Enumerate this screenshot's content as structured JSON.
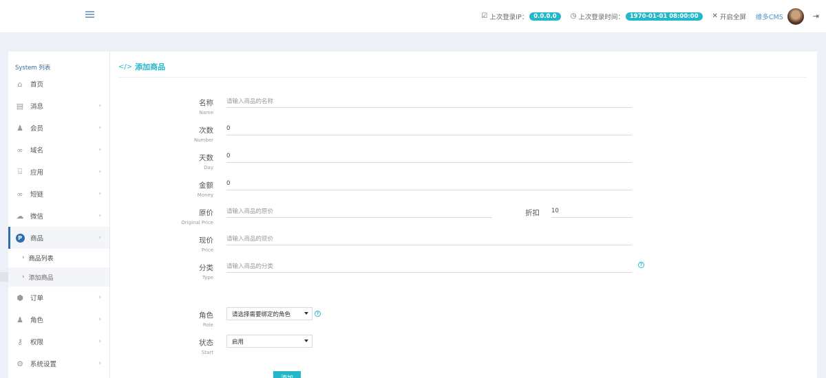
{
  "header": {
    "last_ip_label": "上次登录IP：",
    "last_ip_value": "0.0.0.0",
    "last_time_label": "上次登录时间：",
    "last_time_value": "1970-01-01 08:00:00",
    "fullscreen_label": "开启全屏",
    "cms_link": "维多CMS"
  },
  "sidebar": {
    "title": "System 列表",
    "items": [
      {
        "label": "首页",
        "icon": "home-icon"
      },
      {
        "label": "消息",
        "icon": "document-icon"
      },
      {
        "label": "会员",
        "icon": "user-icon"
      },
      {
        "label": "域名",
        "icon": "link-icon"
      },
      {
        "label": "应用",
        "icon": "gift-icon"
      },
      {
        "label": "短链",
        "icon": "link-icon"
      },
      {
        "label": "微信",
        "icon": "wechat-icon"
      },
      {
        "label": "商品",
        "icon": "product-icon"
      },
      {
        "label": "订单",
        "icon": "order-icon"
      },
      {
        "label": "角色",
        "icon": "user-icon"
      },
      {
        "label": "权限",
        "icon": "key-icon"
      },
      {
        "label": "系统设置",
        "icon": "gears-icon"
      }
    ],
    "sub_items": [
      {
        "label": "商品列表"
      },
      {
        "label": "添加商品"
      }
    ]
  },
  "main": {
    "title": "添加商品",
    "fields": {
      "name": {
        "label": "名称",
        "en": "Name",
        "placeholder": "请输入商品的名称"
      },
      "number": {
        "label": "次数",
        "en": "Number",
        "value": "0"
      },
      "day": {
        "label": "天数",
        "en": "Day",
        "value": "0"
      },
      "money": {
        "label": "金额",
        "en": "Money",
        "value": "0"
      },
      "original_price": {
        "label": "原价",
        "en": "Original Price",
        "placeholder": "请输入商品的原价"
      },
      "discount": {
        "label": "折扣",
        "value": "10"
      },
      "price": {
        "label": "现价",
        "en": "Price",
        "placeholder": "请输入商品的现价"
      },
      "type": {
        "label": "分类",
        "en": "Type",
        "placeholder": "请输入商品的分类"
      },
      "role": {
        "label": "角色",
        "en": "Role",
        "selected": "请选择需要绑定的角色"
      },
      "status": {
        "label": "状态",
        "en": "Start",
        "selected": "启用"
      }
    },
    "submit_label": "添加"
  }
}
